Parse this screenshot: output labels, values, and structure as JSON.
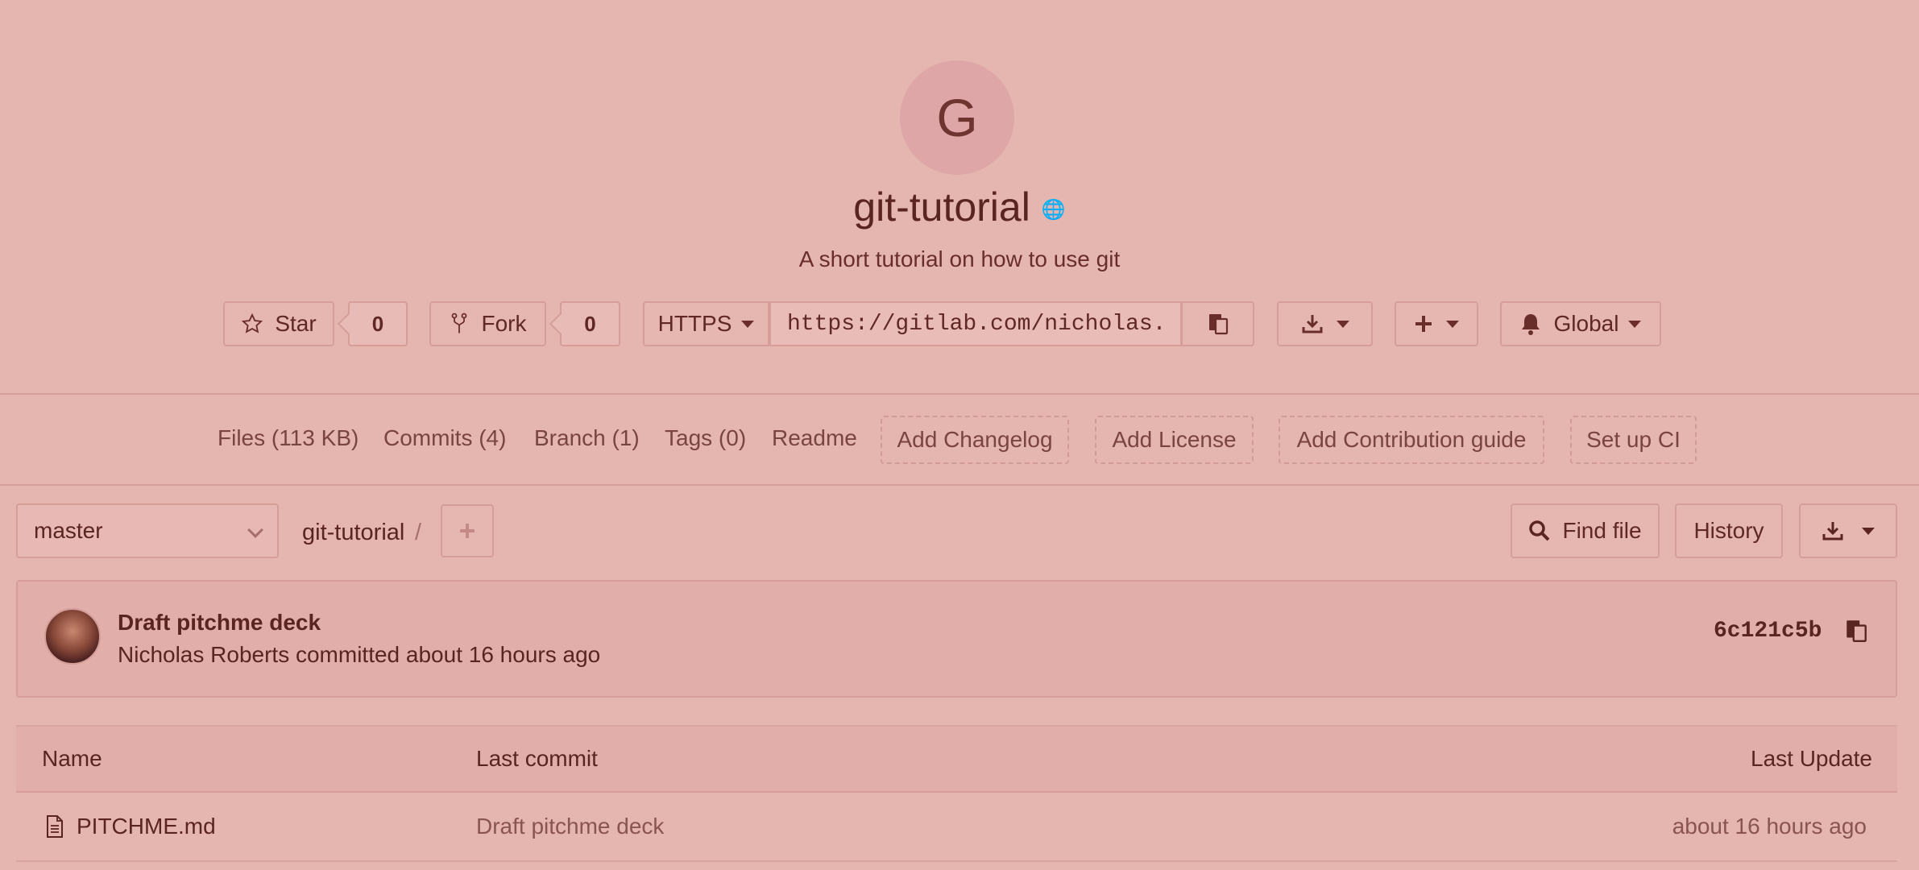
{
  "project": {
    "avatar_letter": "G",
    "name": "git-tutorial",
    "visibility_icon": "globe-icon",
    "description": "A short tutorial on how to use git"
  },
  "actions": {
    "star_label": "Star",
    "star_count": "0",
    "fork_label": "Fork",
    "fork_count": "0",
    "protocol": "HTTPS",
    "clone_url": "https://gitlab.com/nicholas.",
    "notification_level": "Global"
  },
  "nav": {
    "files": "Files (113 KB)",
    "commits": "Commits (4)",
    "branch": "Branch (1)",
    "tags": "Tags (0)",
    "readme": "Readme",
    "add_changelog": "Add Changelog",
    "add_license": "Add License",
    "add_contribution": "Add Contribution guide",
    "setup_ci": "Set up CI"
  },
  "toolbar": {
    "branch": "master",
    "breadcrumb_repo": "git-tutorial",
    "breadcrumb_sep": "/",
    "find_file": "Find file",
    "history": "History"
  },
  "last_commit": {
    "title": "Draft pitchme deck",
    "author_line": "Nicholas Roberts committed about 16 hours ago",
    "sha": "6c121c5b"
  },
  "files_table": {
    "headers": {
      "name": "Name",
      "last_commit": "Last commit",
      "last_update": "Last Update"
    },
    "rows": [
      {
        "name": "PITCHME.md",
        "commit": "Draft pitchme deck",
        "updated": "about 16 hours ago"
      }
    ]
  },
  "colors": {
    "background": "#e5b5b0",
    "text": "#5a2420",
    "border": "#d59e99"
  }
}
